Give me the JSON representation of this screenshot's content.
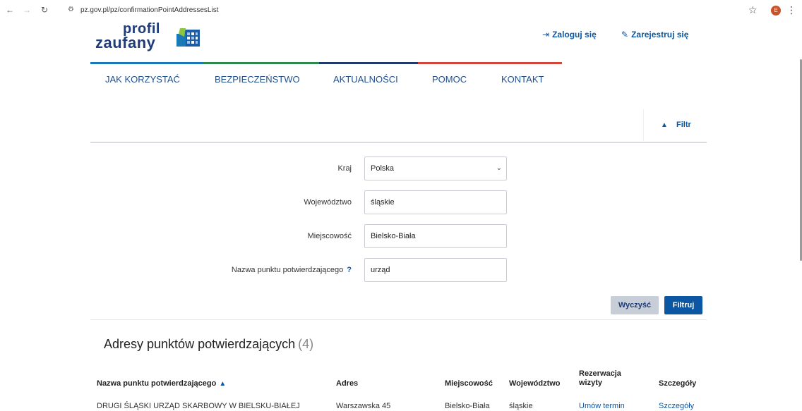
{
  "browser": {
    "url": "pz.gov.pl/pz/confirmationPointAddressesList",
    "profile_initial": "E"
  },
  "header": {
    "logo_line1": "profil",
    "logo_line2": "zaufany",
    "login_label": "Zaloguj się",
    "register_label": "Zarejestruj się"
  },
  "nav": {
    "items": [
      {
        "label": "JAK KORZYSTAĆ"
      },
      {
        "label": "BEZPIECZEŃSTWO"
      },
      {
        "label": "AKTUALNOŚCI"
      },
      {
        "label": "POMOC"
      },
      {
        "label": "KONTAKT"
      }
    ],
    "stripe_colors": [
      "#1a7ab8",
      "#2e8a4a",
      "#203a6e",
      "#d6453a"
    ]
  },
  "filter": {
    "toggle_label": "Filtr",
    "country_label": "Kraj",
    "country_value": "Polska",
    "province_label": "Województwo",
    "province_value": "śląskie",
    "city_label": "Miejscowość",
    "city_value": "Bielsko-Biała",
    "point_name_label": "Nazwa punktu potwierdzającego",
    "point_name_help": "?",
    "point_name_value": "urząd",
    "clear_label": "Wyczyść",
    "filter_label": "Filtruj"
  },
  "results": {
    "title": "Adresy punktów potwierdzających",
    "count": "(4)",
    "columns": {
      "name": "Nazwa punktu potwierdzającego",
      "address": "Adres",
      "city": "Miejscowość",
      "province": "Województwo",
      "reservation": "Rezerwacja wizyty",
      "details": "Szczegóły"
    },
    "rows": [
      {
        "name": "DRUGI ŚLĄSKI URZĄD SKARBOWY W BIELSKU-BIAŁEJ",
        "address": "Warszawska 45",
        "city": "Bielsko-Biała",
        "province": "śląskie",
        "reservation": "Umów termin",
        "details": "Szczegóły"
      }
    ]
  },
  "colors": {
    "primary": "#0b57a4",
    "navy": "#1f3b7a",
    "button_grey": "#c8ced8"
  }
}
